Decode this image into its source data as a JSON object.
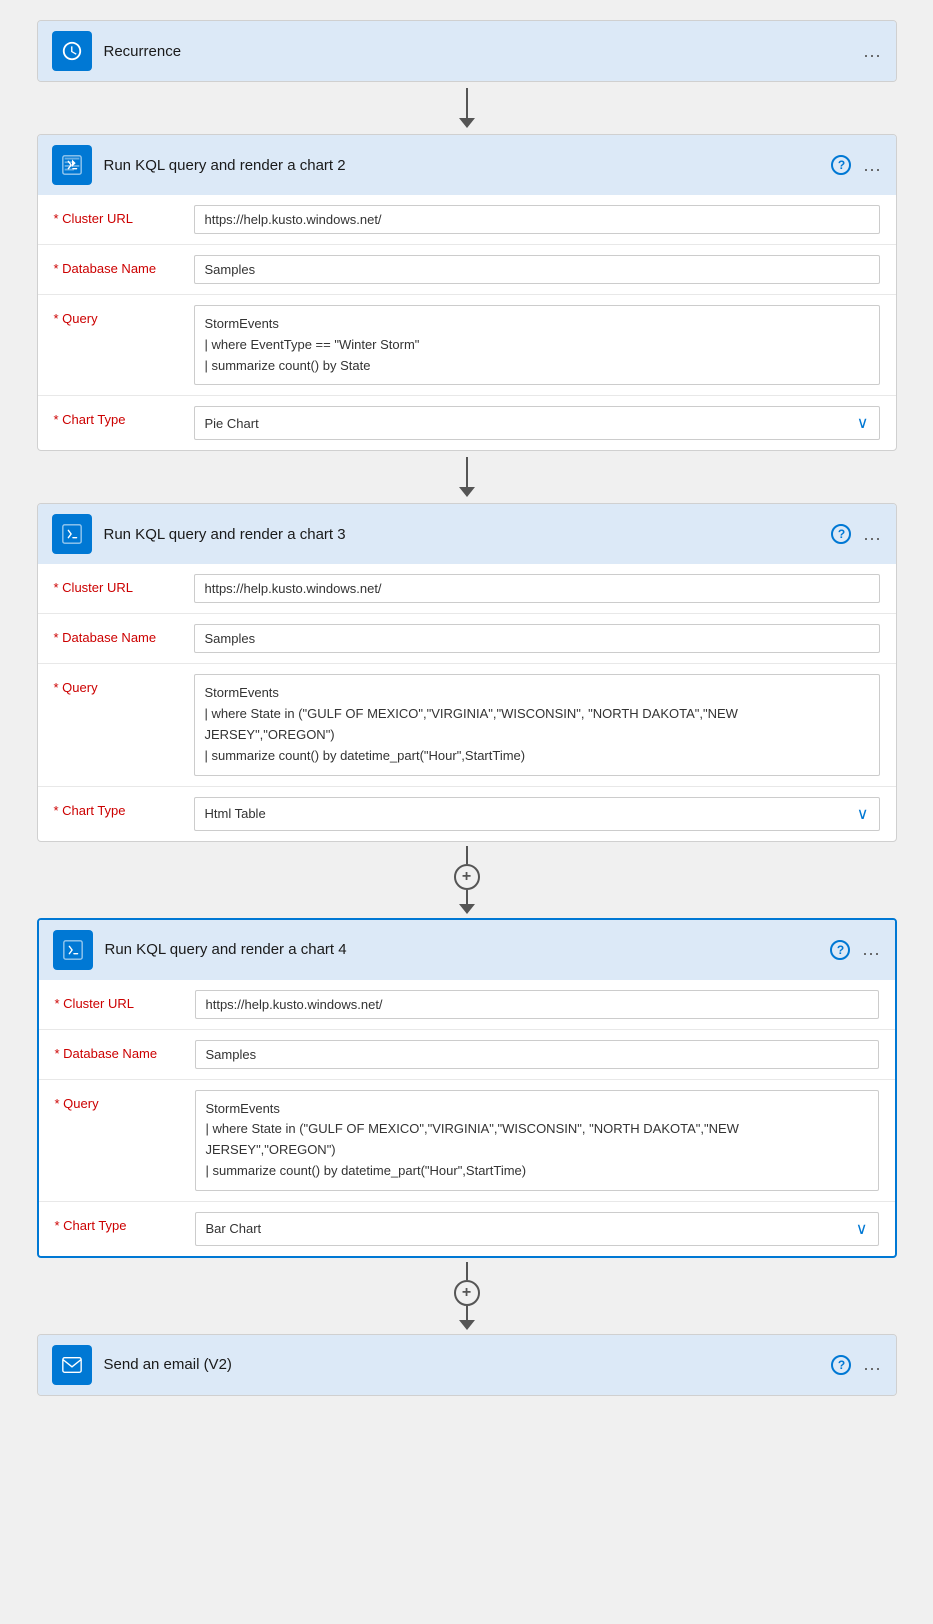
{
  "recurrence": {
    "title": "Recurrence",
    "icon": "clock-icon"
  },
  "card2": {
    "title": "Run KQL query and render a chart 2",
    "cluster_url_label": "* Cluster URL",
    "cluster_url_value": "https://help.kusto.windows.net/",
    "database_name_label": "* Database Name",
    "database_name_value": "Samples",
    "query_label": "* Query",
    "query_value": "StormEvents\n| where EventType == \"Winter Storm\"\n| summarize count() by State",
    "chart_type_label": "* Chart Type",
    "chart_type_value": "Pie Chart"
  },
  "card3": {
    "title": "Run KQL query and render a chart 3",
    "cluster_url_label": "* Cluster URL",
    "cluster_url_value": "https://help.kusto.windows.net/",
    "database_name_label": "* Database Name",
    "database_name_value": "Samples",
    "query_label": "* Query",
    "query_value": "StormEvents\n| where State in (\"GULF OF MEXICO\",\"VIRGINIA\",\"WISCONSIN\", \"NORTH DAKOTA\",\"NEW JERSEY\",\"OREGON\")\n| summarize count() by datetime_part(\"Hour\",StartTime)",
    "chart_type_label": "* Chart Type",
    "chart_type_value": "Html Table"
  },
  "card4": {
    "title": "Run KQL query and render a chart 4",
    "cluster_url_label": "* Cluster URL",
    "cluster_url_value": "https://help.kusto.windows.net/",
    "database_name_label": "* Database Name",
    "database_name_value": "Samples",
    "query_label": "* Query",
    "query_value": "StormEvents\n| where State in (\"GULF OF MEXICO\",\"VIRGINIA\",\"WISCONSIN\", \"NORTH DAKOTA\",\"NEW JERSEY\",\"OREGON\")\n| summarize count() by datetime_part(\"Hour\",StartTime)",
    "chart_type_label": "* Chart Type",
    "chart_type_value": "Bar Chart"
  },
  "email_card": {
    "title": "Send an email (V2)",
    "icon": "email-icon"
  },
  "ui": {
    "help_label": "?",
    "more_label": "...",
    "plus_label": "+",
    "chevron_down": "∨"
  }
}
